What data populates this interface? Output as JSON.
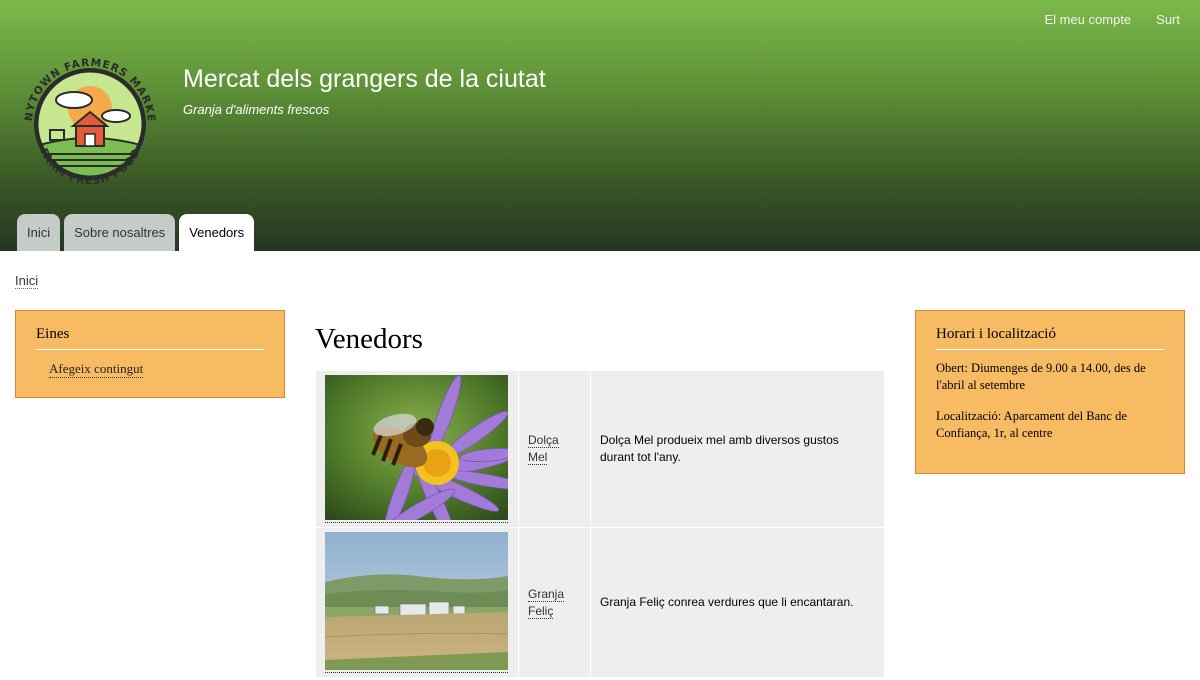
{
  "secondary_menu": {
    "account": "El meu compte",
    "logout": "Surt"
  },
  "site": {
    "name": "Mercat dels grangers de la ciutat",
    "slogan": "Granja d'aliments  frescos",
    "logo_text_top": "ANYTOWN FARMERS MARKET",
    "logo_text_bottom": "FARM FRESH FOOD"
  },
  "main_menu": [
    {
      "label": "Inici"
    },
    {
      "label": "Sobre nosaltres"
    },
    {
      "label": "Venedors",
      "active": true
    }
  ],
  "breadcrumb": {
    "home": "Inici"
  },
  "tools_block": {
    "title": "Eines",
    "link": "Afegeix contingut"
  },
  "hours_block": {
    "title": "Horari i localització",
    "hours": "Obert: Diumenges de 9.00 a 14.00, des de l'abril al setembre",
    "location": "Localització: Aparcament del Banc de Confiança, 1r, al centre"
  },
  "content": {
    "title": "Venedors",
    "vendors": [
      {
        "name_line1": "Dolça",
        "name_line2": "Mel",
        "description": "Dolça Mel produeix mel amb diversos gustos durant tot l'any.",
        "image": "bee-on-flower-photo"
      },
      {
        "name_line1": "Granja",
        "name_line2": "Feliç",
        "description": "Granja Feliç conrea verdures que li encantaran.",
        "image": "farm-landscape-photo"
      }
    ]
  },
  "colors": {
    "header_top": "#7cba4a",
    "header_bottom": "#253623",
    "block_bg": "#f7bb63",
    "block_border": "#e2802f",
    "table_bg": "#eeeeee"
  }
}
